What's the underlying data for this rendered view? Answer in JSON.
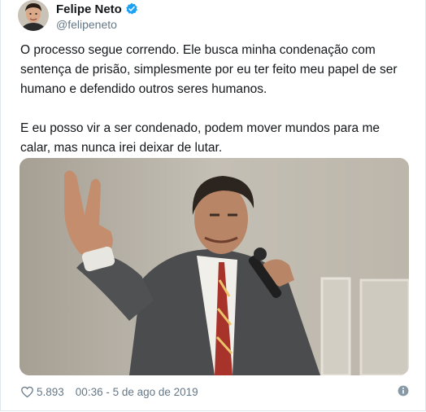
{
  "user": {
    "display_name": "Felipe Neto",
    "handle": "@felipeneto",
    "verified": true,
    "avatar_icon": "profile-avatar"
  },
  "tweet": {
    "text": "O processo segue correndo. Ele busca minha condenação com sentença de prisão, simplesmente por eu ter feito meu papel de ser humano e defendido outros seres humanos.\n\nE eu posso vir a ser condenado, podem mover mundos para me calar, mas nunca irei deixar de lutar.",
    "image_icon": "photo-man-raising-hand-with-microphone"
  },
  "footer": {
    "likes": "5.893",
    "timestamp": "00:36 - 5 de ago de 2019",
    "like_icon": "heart-icon",
    "info_icon": "info-icon"
  },
  "colors": {
    "text": "#14171a",
    "secondary": "#657786",
    "verified": "#1da1f2",
    "border": "#e1e8ed"
  }
}
